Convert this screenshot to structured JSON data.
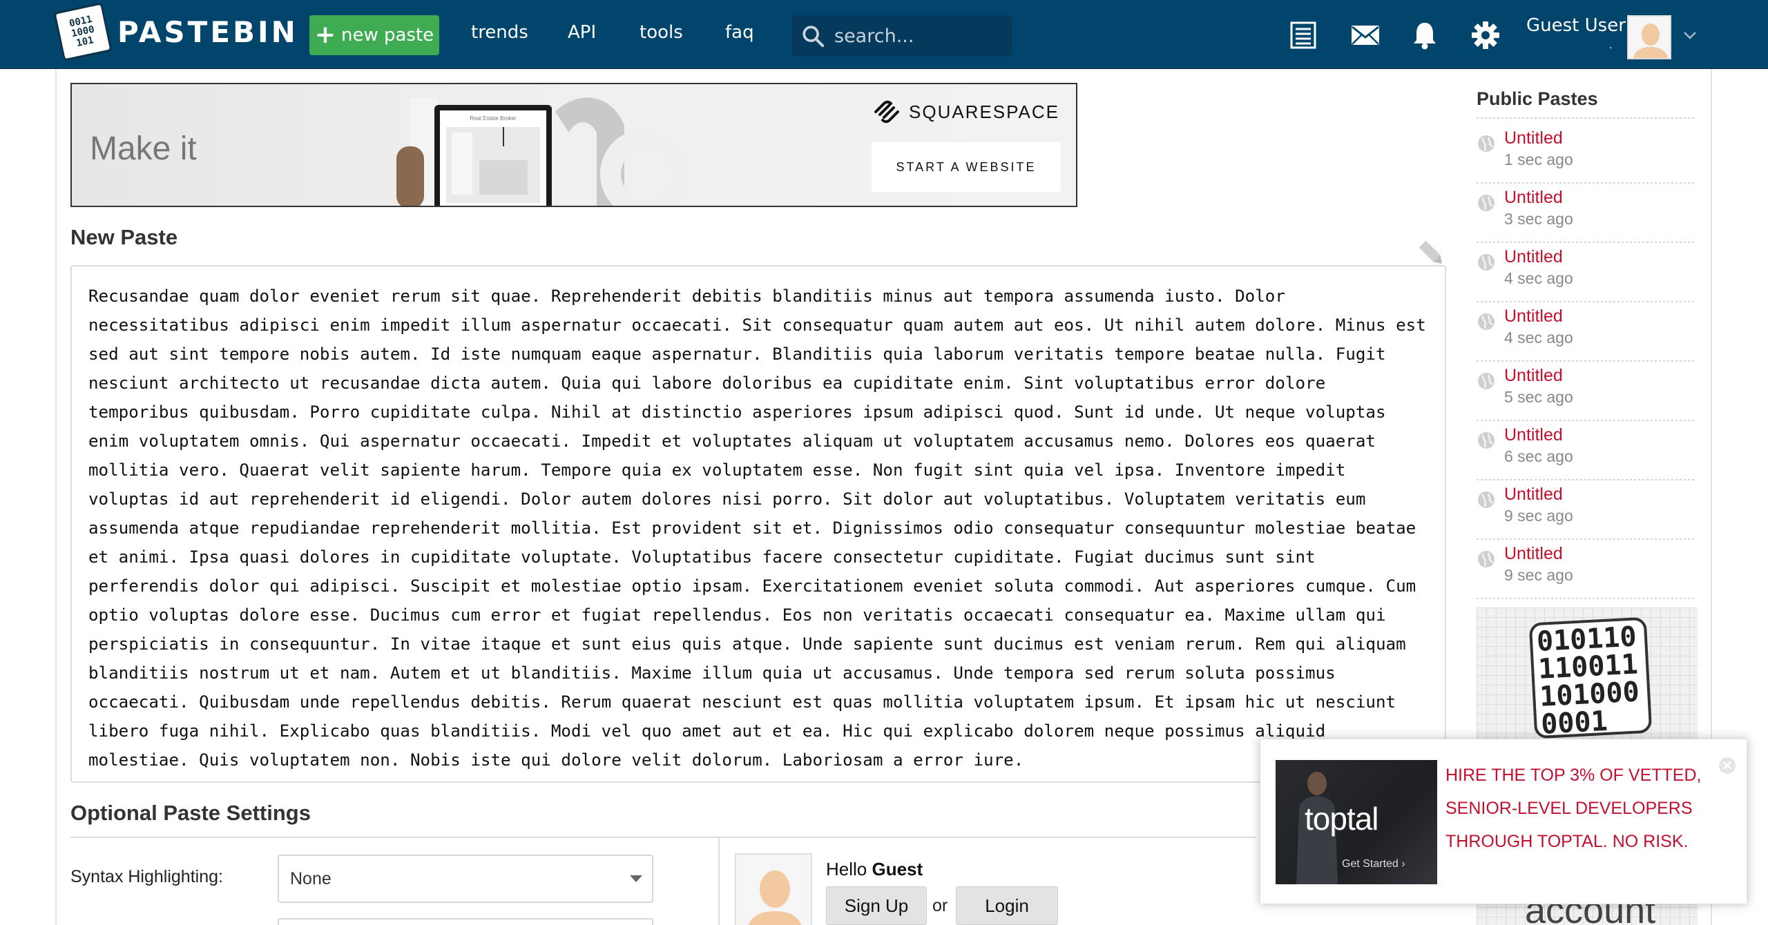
{
  "header": {
    "logo_bits": "0011\n1000\n101",
    "logo_text": "PASTEBIN",
    "new_paste_label": "new paste",
    "nav": [
      "trends",
      "API",
      "tools",
      "faq"
    ],
    "search_placeholder": "search...",
    "user_name": "Guest User",
    "user_dot": ".",
    "colors": {
      "bar": "#02456c",
      "new_paste": "#3fab53"
    }
  },
  "ad_banner": {
    "headline": "Make it",
    "brand": "SQUARESPACE",
    "cta": "START A WEBSITE",
    "laptop_caption": "Real Estate Broker"
  },
  "new_paste": {
    "title": "New Paste",
    "text": "Recusandae quam dolor eveniet rerum sit quae. Reprehenderit debitis blanditiis minus aut tempora assumenda iusto. Dolor necessitatibus adipisci enim impedit illum aspernatur occaecati. Sit consequatur quam autem aut eos. Ut nihil autem dolore. Minus est sed aut sint tempore nobis autem. Id iste numquam eaque aspernatur. Blanditiis quia laborum veritatis tempore beatae nulla. Fugit nesciunt architecto ut recusandae dicta autem. Quia qui labore doloribus ea cupiditate enim. Sint voluptatibus error dolore temporibus quibusdam. Porro cupiditate culpa. Nihil at distinctio asperiores ipsum adipisci quod. Sunt id unde. Ut neque voluptas enim voluptatem omnis. Qui aspernatur occaecati. Impedit et voluptates aliquam ut voluptatem accusamus nemo. Dolores eos quaerat mollitia vero. Quaerat velit sapiente harum. Tempore quia ex voluptatem esse. Non fugit sint quia vel ipsa. Inventore impedit voluptas id aut reprehenderit id eligendi. Dolor autem dolores nisi porro. Sit dolor aut voluptatibus. Voluptatem veritatis eum assumenda atque repudiandae reprehenderit mollitia. Est provident sit et. Dignissimos odio consequatur consequuntur molestiae beatae et animi. Ipsa quasi dolores in cupiditate voluptate. Voluptatibus facere consectetur cupiditate. Fugiat ducimus sunt sint perferendis dolor qui adipisci. Suscipit et molestiae optio ipsam. Exercitationem eveniet soluta commodi. Aut asperiores cumque. Cum optio voluptas dolore esse. Ducimus cum error et fugiat repellendus. Eos non veritatis occaecati consequatur ea. Maxime ullam qui perspiciatis in consequuntur. In vitae itaque et sunt eius quis atque. Unde sapiente sunt ducimus est veniam rerum. Rem qui aliquam blanditiis nostrum ut et nam. Autem et ut blanditiis. Maxime illum quia ut accusamus. Unde tempora sed rerum soluta possimus occaecati. Quibusdam unde repellendus debitis. Rerum quaerat nesciunt est quas mollitia voluptatem ipsum. Et ipsam hic ut nesciunt libero fuga nihil. Explicabo quas blanditiis. Modi vel quo amet aut et ea. Hic qui explicabo dolorem neque possimus aliquid molestiae. Quis voluptatem non. Nobis iste qui dolore velit dolorum. Laboriosam a error iure."
  },
  "settings": {
    "title": "Optional Paste Settings",
    "syntax_label": "Syntax Highlighting:",
    "syntax_value": "None"
  },
  "login": {
    "hello_prefix": "Hello",
    "hello_name": "Guest",
    "sign_up": "Sign Up",
    "or": "or",
    "login": "Login"
  },
  "sidebar": {
    "title": "Public Pastes",
    "items": [
      {
        "name": "Untitled",
        "time": "1 sec ago"
      },
      {
        "name": "Untitled",
        "time": "3 sec ago"
      },
      {
        "name": "Untitled",
        "time": "4 sec ago"
      },
      {
        "name": "Untitled",
        "time": "4 sec ago"
      },
      {
        "name": "Untitled",
        "time": "5 sec ago"
      },
      {
        "name": "Untitled",
        "time": "6 sec ago"
      },
      {
        "name": "Untitled",
        "time": "9 sec ago"
      },
      {
        "name": "Untitled",
        "time": "9 sec ago"
      }
    ],
    "ad_bits": "010110\n110011\n101000\n0001",
    "ad_caption": "account"
  },
  "popup": {
    "brand": "toptal",
    "get_started": "Get Started ›",
    "text": "HIRE THE TOP 3% OF VETTED, SENIOR-LEVEL DEVELOPERS THROUGH TOPTAL. NO RISK.",
    "color": "#c3102e"
  }
}
